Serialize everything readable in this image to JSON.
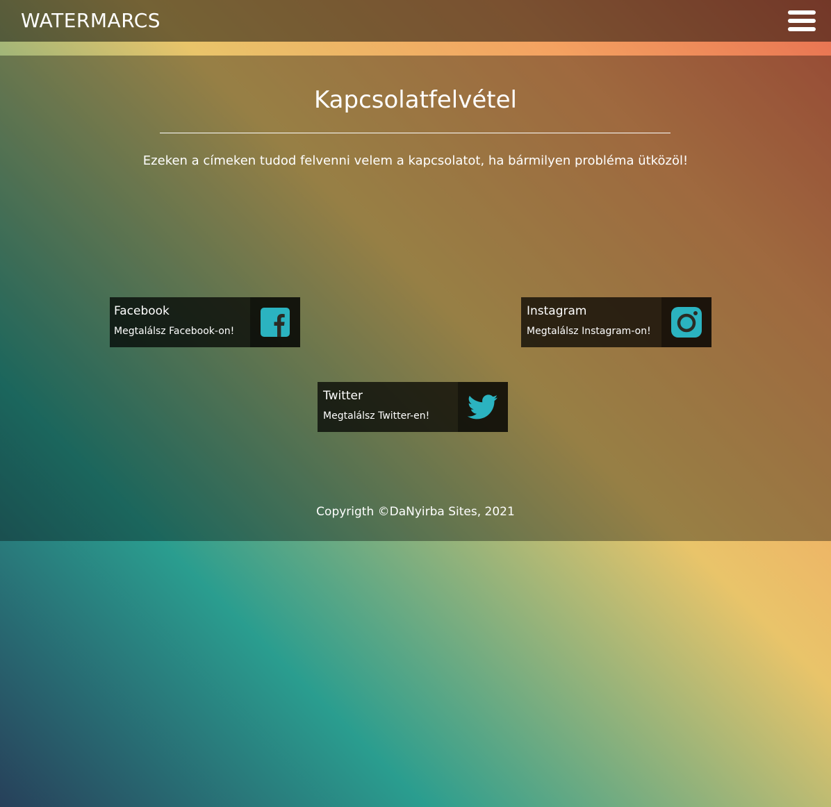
{
  "header": {
    "brand": "WATERMARCS",
    "menu_icon": "hamburger-menu-icon"
  },
  "main": {
    "title": "Kapcsolatfelvétel",
    "intro": "Ezeken a címeken tudod felvenni velem a kapcsolatot, ha bármilyen probléma ütközöl!"
  },
  "social": {
    "facebook": {
      "name": "Facebook",
      "subtitle": "Megtalálsz Facebook-on!",
      "icon": "facebook-icon"
    },
    "instagram": {
      "name": "Instagram",
      "subtitle": "Megtalálsz Instagram-on!",
      "icon": "instagram-icon"
    },
    "twitter": {
      "name": "Twitter",
      "subtitle": "Megtalálsz Twitter-en!",
      "icon": "twitter-icon"
    }
  },
  "footer": {
    "copyright": "Copyrigth ©DaNyirba Sites, 2021"
  },
  "colors": {
    "icon_accent": "#2bb3c0",
    "header_bg": "rgba(0,0,0,0.5)"
  }
}
